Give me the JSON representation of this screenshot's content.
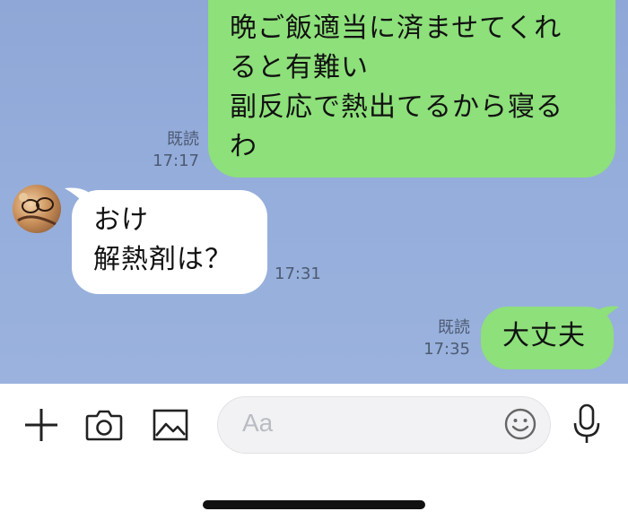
{
  "messages": [
    {
      "direction": "outgoing",
      "lines": [
        "晩ご飯適当に済ませてくれ",
        "ると有難い",
        "副反応で熱出てるから寝る",
        "わ"
      ],
      "read_label": "既読",
      "time": "17:17"
    },
    {
      "direction": "incoming",
      "lines": [
        "おけ",
        "解熱剤は？"
      ],
      "time": "17:31"
    },
    {
      "direction": "outgoing",
      "lines": [
        "大丈夫"
      ],
      "read_label": "既読",
      "time": "17:35"
    }
  ],
  "input": {
    "placeholder": "Aa"
  },
  "icons": {
    "add": "plus-icon",
    "camera": "camera-icon",
    "image": "image-icon",
    "emoji": "emoji-icon",
    "voice": "microphone-icon"
  },
  "colors": {
    "chat_background": "#95addb",
    "outgoing_bubble": "#8de07a",
    "incoming_bubble": "#ffffff",
    "meta_text": "#4d5a72"
  }
}
